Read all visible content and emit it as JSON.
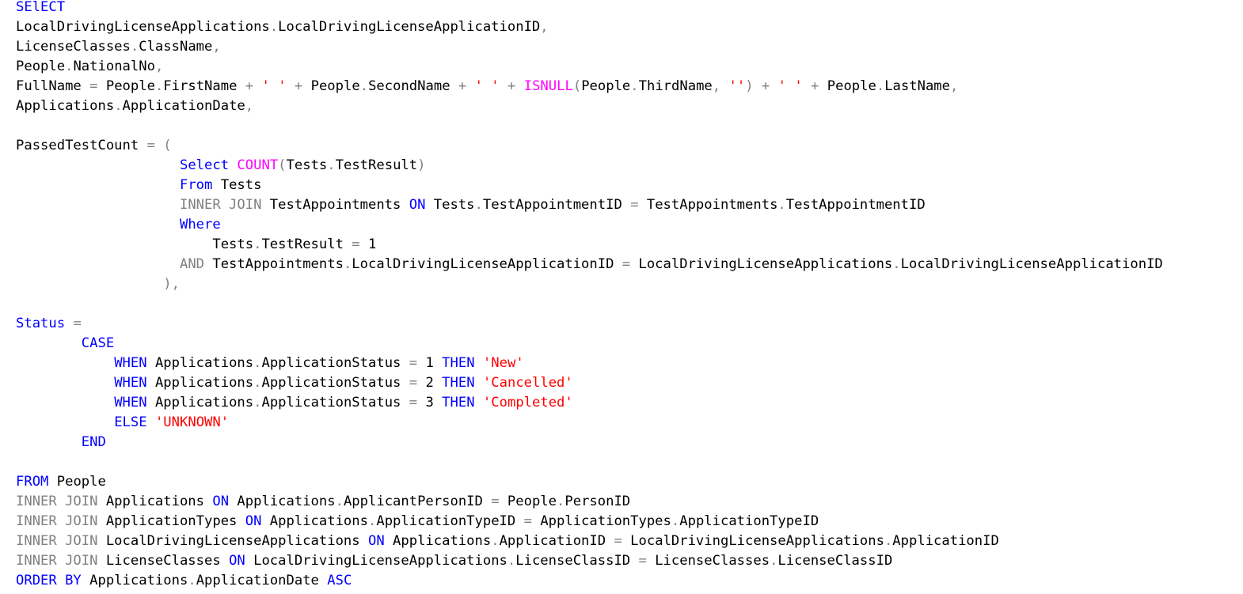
{
  "colors": {
    "keyword": "#0000ff",
    "operator": "#808080",
    "function": "#ff00ff",
    "string": "#ff0000",
    "identifier": "#000000",
    "background": "#ffffff"
  },
  "lines": [
    [
      {
        "t": "SElECT",
        "c": "kw"
      }
    ],
    [
      {
        "t": "LocalDrivingLicenseApplications",
        "c": "id"
      },
      {
        "t": ".",
        "c": "op"
      },
      {
        "t": "LocalDrivingLicenseApplicationID",
        "c": "id"
      },
      {
        "t": ",",
        "c": "op"
      }
    ],
    [
      {
        "t": "LicenseClasses",
        "c": "id"
      },
      {
        "t": ".",
        "c": "op"
      },
      {
        "t": "ClassName",
        "c": "id"
      },
      {
        "t": ",",
        "c": "op"
      }
    ],
    [
      {
        "t": "People",
        "c": "id"
      },
      {
        "t": ".",
        "c": "op"
      },
      {
        "t": "NationalNo",
        "c": "id"
      },
      {
        "t": ",",
        "c": "op"
      }
    ],
    [
      {
        "t": "FullName ",
        "c": "id"
      },
      {
        "t": "=",
        "c": "op"
      },
      {
        "t": " People",
        "c": "id"
      },
      {
        "t": ".",
        "c": "op"
      },
      {
        "t": "FirstName ",
        "c": "id"
      },
      {
        "t": "+",
        "c": "op"
      },
      {
        "t": " ",
        "c": "id"
      },
      {
        "t": "' '",
        "c": "str"
      },
      {
        "t": " ",
        "c": "id"
      },
      {
        "t": "+",
        "c": "op"
      },
      {
        "t": " People",
        "c": "id"
      },
      {
        "t": ".",
        "c": "op"
      },
      {
        "t": "SecondName ",
        "c": "id"
      },
      {
        "t": "+",
        "c": "op"
      },
      {
        "t": " ",
        "c": "id"
      },
      {
        "t": "' '",
        "c": "str"
      },
      {
        "t": " ",
        "c": "id"
      },
      {
        "t": "+",
        "c": "op"
      },
      {
        "t": " ",
        "c": "id"
      },
      {
        "t": "ISNULL",
        "c": "fn"
      },
      {
        "t": "(",
        "c": "op"
      },
      {
        "t": "People",
        "c": "id"
      },
      {
        "t": ".",
        "c": "op"
      },
      {
        "t": "ThirdName",
        "c": "id"
      },
      {
        "t": ",",
        "c": "op"
      },
      {
        "t": " ",
        "c": "id"
      },
      {
        "t": "''",
        "c": "str"
      },
      {
        "t": ")",
        "c": "op"
      },
      {
        "t": " ",
        "c": "id"
      },
      {
        "t": "+",
        "c": "op"
      },
      {
        "t": " ",
        "c": "id"
      },
      {
        "t": "' '",
        "c": "str"
      },
      {
        "t": " ",
        "c": "id"
      },
      {
        "t": "+",
        "c": "op"
      },
      {
        "t": " People",
        "c": "id"
      },
      {
        "t": ".",
        "c": "op"
      },
      {
        "t": "LastName",
        "c": "id"
      },
      {
        "t": ",",
        "c": "op"
      }
    ],
    [
      {
        "t": "Applications",
        "c": "id"
      },
      {
        "t": ".",
        "c": "op"
      },
      {
        "t": "ApplicationDate",
        "c": "id"
      },
      {
        "t": ",",
        "c": "op"
      }
    ],
    [],
    [
      {
        "t": "PassedTestCount ",
        "c": "id"
      },
      {
        "t": "=",
        "c": "op"
      },
      {
        "t": " ",
        "c": "id"
      },
      {
        "t": "(",
        "c": "op"
      }
    ],
    [
      {
        "t": "                    ",
        "c": "id"
      },
      {
        "t": "Select",
        "c": "kw"
      },
      {
        "t": " ",
        "c": "id"
      },
      {
        "t": "COUNT",
        "c": "fn"
      },
      {
        "t": "(",
        "c": "op"
      },
      {
        "t": "Tests",
        "c": "id"
      },
      {
        "t": ".",
        "c": "op"
      },
      {
        "t": "TestResult",
        "c": "id"
      },
      {
        "t": ")",
        "c": "op"
      }
    ],
    [
      {
        "t": "                    ",
        "c": "id"
      },
      {
        "t": "From",
        "c": "kw"
      },
      {
        "t": " Tests",
        "c": "id"
      }
    ],
    [
      {
        "t": "                    ",
        "c": "id"
      },
      {
        "t": "INNER JOIN",
        "c": "op"
      },
      {
        "t": " TestAppointments ",
        "c": "id"
      },
      {
        "t": "ON",
        "c": "kw"
      },
      {
        "t": " Tests",
        "c": "id"
      },
      {
        "t": ".",
        "c": "op"
      },
      {
        "t": "TestAppointmentID ",
        "c": "id"
      },
      {
        "t": "=",
        "c": "op"
      },
      {
        "t": " TestAppointments",
        "c": "id"
      },
      {
        "t": ".",
        "c": "op"
      },
      {
        "t": "TestAppointmentID",
        "c": "id"
      }
    ],
    [
      {
        "t": "                    ",
        "c": "id"
      },
      {
        "t": "Where",
        "c": "kw"
      }
    ],
    [
      {
        "t": "                        Tests",
        "c": "id"
      },
      {
        "t": ".",
        "c": "op"
      },
      {
        "t": "TestResult ",
        "c": "id"
      },
      {
        "t": "=",
        "c": "op"
      },
      {
        "t": " 1",
        "c": "id"
      }
    ],
    [
      {
        "t": "                    ",
        "c": "id"
      },
      {
        "t": "AND",
        "c": "op"
      },
      {
        "t": " TestAppointments",
        "c": "id"
      },
      {
        "t": ".",
        "c": "op"
      },
      {
        "t": "LocalDrivingLicenseApplicationID ",
        "c": "id"
      },
      {
        "t": "=",
        "c": "op"
      },
      {
        "t": " LocalDrivingLicenseApplications",
        "c": "id"
      },
      {
        "t": ".",
        "c": "op"
      },
      {
        "t": "LocalDrivingLicenseApplicationID",
        "c": "id"
      }
    ],
    [
      {
        "t": "                  ",
        "c": "id"
      },
      {
        "t": "),",
        "c": "op"
      }
    ],
    [],
    [
      {
        "t": "Status",
        "c": "kw"
      },
      {
        "t": " ",
        "c": "id"
      },
      {
        "t": "=",
        "c": "op"
      }
    ],
    [
      {
        "t": "        ",
        "c": "id"
      },
      {
        "t": "CASE",
        "c": "kw"
      }
    ],
    [
      {
        "t": "            ",
        "c": "id"
      },
      {
        "t": "WHEN",
        "c": "kw"
      },
      {
        "t": " Applications",
        "c": "id"
      },
      {
        "t": ".",
        "c": "op"
      },
      {
        "t": "ApplicationStatus ",
        "c": "id"
      },
      {
        "t": "=",
        "c": "op"
      },
      {
        "t": " 1 ",
        "c": "id"
      },
      {
        "t": "THEN",
        "c": "kw"
      },
      {
        "t": " ",
        "c": "id"
      },
      {
        "t": "'New'",
        "c": "str"
      }
    ],
    [
      {
        "t": "            ",
        "c": "id"
      },
      {
        "t": "WHEN",
        "c": "kw"
      },
      {
        "t": " Applications",
        "c": "id"
      },
      {
        "t": ".",
        "c": "op"
      },
      {
        "t": "ApplicationStatus ",
        "c": "id"
      },
      {
        "t": "=",
        "c": "op"
      },
      {
        "t": " 2 ",
        "c": "id"
      },
      {
        "t": "THEN",
        "c": "kw"
      },
      {
        "t": " ",
        "c": "id"
      },
      {
        "t": "'Cancelled'",
        "c": "str"
      }
    ],
    [
      {
        "t": "            ",
        "c": "id"
      },
      {
        "t": "WHEN",
        "c": "kw"
      },
      {
        "t": " Applications",
        "c": "id"
      },
      {
        "t": ".",
        "c": "op"
      },
      {
        "t": "ApplicationStatus ",
        "c": "id"
      },
      {
        "t": "=",
        "c": "op"
      },
      {
        "t": " 3 ",
        "c": "id"
      },
      {
        "t": "THEN",
        "c": "kw"
      },
      {
        "t": " ",
        "c": "id"
      },
      {
        "t": "'Completed'",
        "c": "str"
      }
    ],
    [
      {
        "t": "            ",
        "c": "id"
      },
      {
        "t": "ELSE",
        "c": "kw"
      },
      {
        "t": " ",
        "c": "id"
      },
      {
        "t": "'UNKNOWN'",
        "c": "str"
      }
    ],
    [
      {
        "t": "        ",
        "c": "id"
      },
      {
        "t": "END",
        "c": "kw"
      }
    ],
    [],
    [
      {
        "t": "FROM",
        "c": "kw"
      },
      {
        "t": " People",
        "c": "id"
      }
    ],
    [
      {
        "t": "INNER JOIN",
        "c": "op"
      },
      {
        "t": " Applications ",
        "c": "id"
      },
      {
        "t": "ON",
        "c": "kw"
      },
      {
        "t": " Applications",
        "c": "id"
      },
      {
        "t": ".",
        "c": "op"
      },
      {
        "t": "ApplicantPersonID ",
        "c": "id"
      },
      {
        "t": "=",
        "c": "op"
      },
      {
        "t": " People",
        "c": "id"
      },
      {
        "t": ".",
        "c": "op"
      },
      {
        "t": "PersonID",
        "c": "id"
      }
    ],
    [
      {
        "t": "INNER JOIN",
        "c": "op"
      },
      {
        "t": " ApplicationTypes ",
        "c": "id"
      },
      {
        "t": "ON",
        "c": "kw"
      },
      {
        "t": " Applications",
        "c": "id"
      },
      {
        "t": ".",
        "c": "op"
      },
      {
        "t": "ApplicationTypeID ",
        "c": "id"
      },
      {
        "t": "=",
        "c": "op"
      },
      {
        "t": " ApplicationTypes",
        "c": "id"
      },
      {
        "t": ".",
        "c": "op"
      },
      {
        "t": "ApplicationTypeID",
        "c": "id"
      }
    ],
    [
      {
        "t": "INNER JOIN",
        "c": "op"
      },
      {
        "t": " LocalDrivingLicenseApplications ",
        "c": "id"
      },
      {
        "t": "ON",
        "c": "kw"
      },
      {
        "t": " Applications",
        "c": "id"
      },
      {
        "t": ".",
        "c": "op"
      },
      {
        "t": "ApplicationID ",
        "c": "id"
      },
      {
        "t": "=",
        "c": "op"
      },
      {
        "t": " LocalDrivingLicenseApplications",
        "c": "id"
      },
      {
        "t": ".",
        "c": "op"
      },
      {
        "t": "ApplicationID",
        "c": "id"
      }
    ],
    [
      {
        "t": "INNER JOIN",
        "c": "op"
      },
      {
        "t": " LicenseClasses ",
        "c": "id"
      },
      {
        "t": "ON",
        "c": "kw"
      },
      {
        "t": " LocalDrivingLicenseApplications",
        "c": "id"
      },
      {
        "t": ".",
        "c": "op"
      },
      {
        "t": "LicenseClassID ",
        "c": "id"
      },
      {
        "t": "=",
        "c": "op"
      },
      {
        "t": " LicenseClasses",
        "c": "id"
      },
      {
        "t": ".",
        "c": "op"
      },
      {
        "t": "LicenseClassID",
        "c": "id"
      }
    ],
    [
      {
        "t": "ORDER BY",
        "c": "kw"
      },
      {
        "t": " Applications",
        "c": "id"
      },
      {
        "t": ".",
        "c": "op"
      },
      {
        "t": "ApplicationDate ",
        "c": "id"
      },
      {
        "t": "ASC",
        "c": "kw"
      }
    ]
  ]
}
